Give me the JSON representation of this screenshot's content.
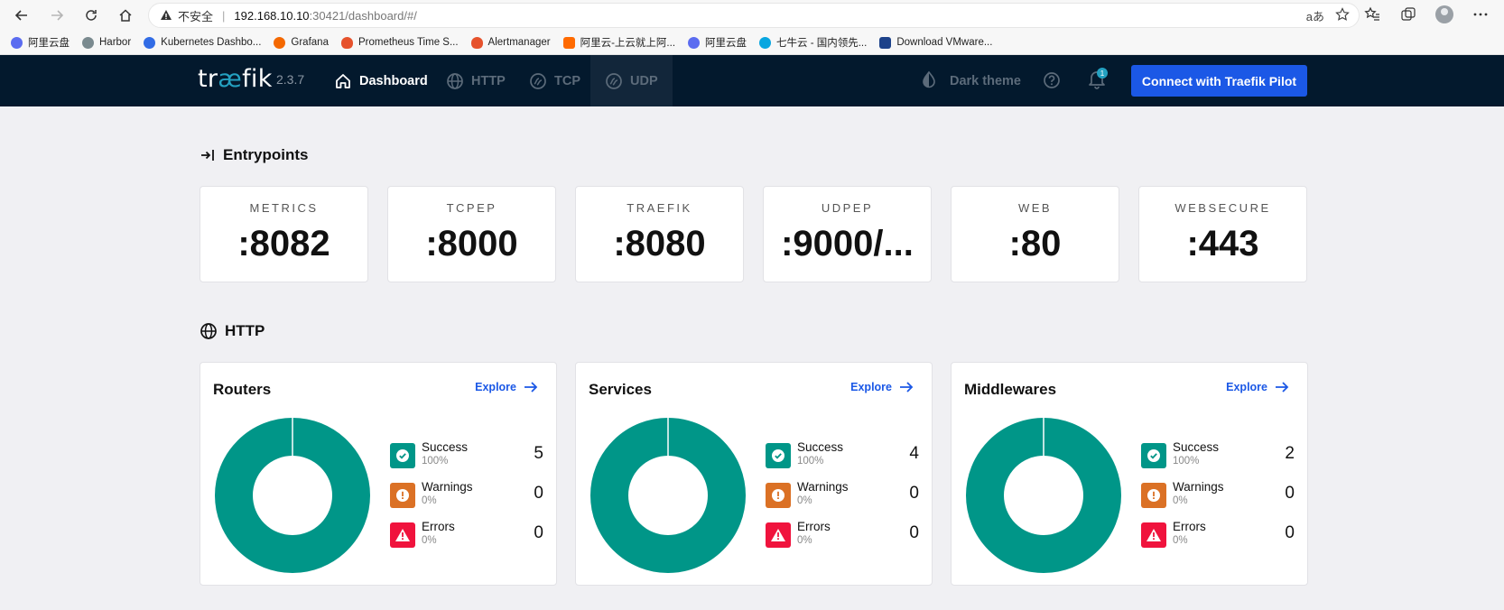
{
  "browser": {
    "insecure_label": "不安全",
    "url_host": "192.168.10.10",
    "url_path": ":30421/dashboard/#/",
    "reader_label": "aあ",
    "bookmarks": [
      {
        "label": "阿里云盘",
        "color": "#5b6cf0"
      },
      {
        "label": "Harbor",
        "color": "#7a8a8f"
      },
      {
        "label": "Kubernetes Dashbo...",
        "color": "#326ce5"
      },
      {
        "label": "Grafana",
        "color": "#f46800"
      },
      {
        "label": "Prometheus Time S...",
        "color": "#e6522c"
      },
      {
        "label": "Alertmanager",
        "color": "#e6522c"
      },
      {
        "label": "阿里云-上云就上阿...",
        "color": "#ff6a00"
      },
      {
        "label": "阿里云盘",
        "color": "#5b6cf0"
      },
      {
        "label": "七牛云 - 国内领先...",
        "color": "#08a6e0"
      },
      {
        "label": "Download VMware...",
        "color": "#1d428a"
      }
    ]
  },
  "topbar": {
    "logo_pre": "tr",
    "logo_ae": "æ",
    "logo_post": "fik",
    "version": "2.3.7",
    "nav": [
      "Dashboard",
      "HTTP",
      "TCP",
      "UDP"
    ],
    "dark_theme": "Dark theme",
    "notification_count": "1",
    "pilot_button": "Connect with Traefik Pilot"
  },
  "entrypoints": {
    "title": "Entrypoints",
    "items": [
      {
        "name": "METRICS",
        "port": ":8082"
      },
      {
        "name": "TCPEP",
        "port": ":8000"
      },
      {
        "name": "TRAEFIK",
        "port": ":8080"
      },
      {
        "name": "UDPEP",
        "port": ":9000/..."
      },
      {
        "name": "WEB",
        "port": ":80"
      },
      {
        "name": "WEBSECURE",
        "port": ":443"
      }
    ]
  },
  "http": {
    "title": "HTTP",
    "explore_label": "Explore",
    "cards": [
      {
        "title": "Routers",
        "stats": [
          {
            "label": "Success",
            "pct": "100%",
            "count": "5"
          },
          {
            "label": "Warnings",
            "pct": "0%",
            "count": "0"
          },
          {
            "label": "Errors",
            "pct": "0%",
            "count": "0"
          }
        ]
      },
      {
        "title": "Services",
        "stats": [
          {
            "label": "Success",
            "pct": "100%",
            "count": "4"
          },
          {
            "label": "Warnings",
            "pct": "0%",
            "count": "0"
          },
          {
            "label": "Errors",
            "pct": "0%",
            "count": "0"
          }
        ]
      },
      {
        "title": "Middlewares",
        "stats": [
          {
            "label": "Success",
            "pct": "100%",
            "count": "2"
          },
          {
            "label": "Warnings",
            "pct": "0%",
            "count": "0"
          },
          {
            "label": "Errors",
            "pct": "0%",
            "count": "0"
          }
        ]
      }
    ]
  },
  "colors": {
    "success": "#009688",
    "warning": "#db7125",
    "error": "#f0133d",
    "accent": "#1b58e6",
    "topbar": "#03192d"
  }
}
